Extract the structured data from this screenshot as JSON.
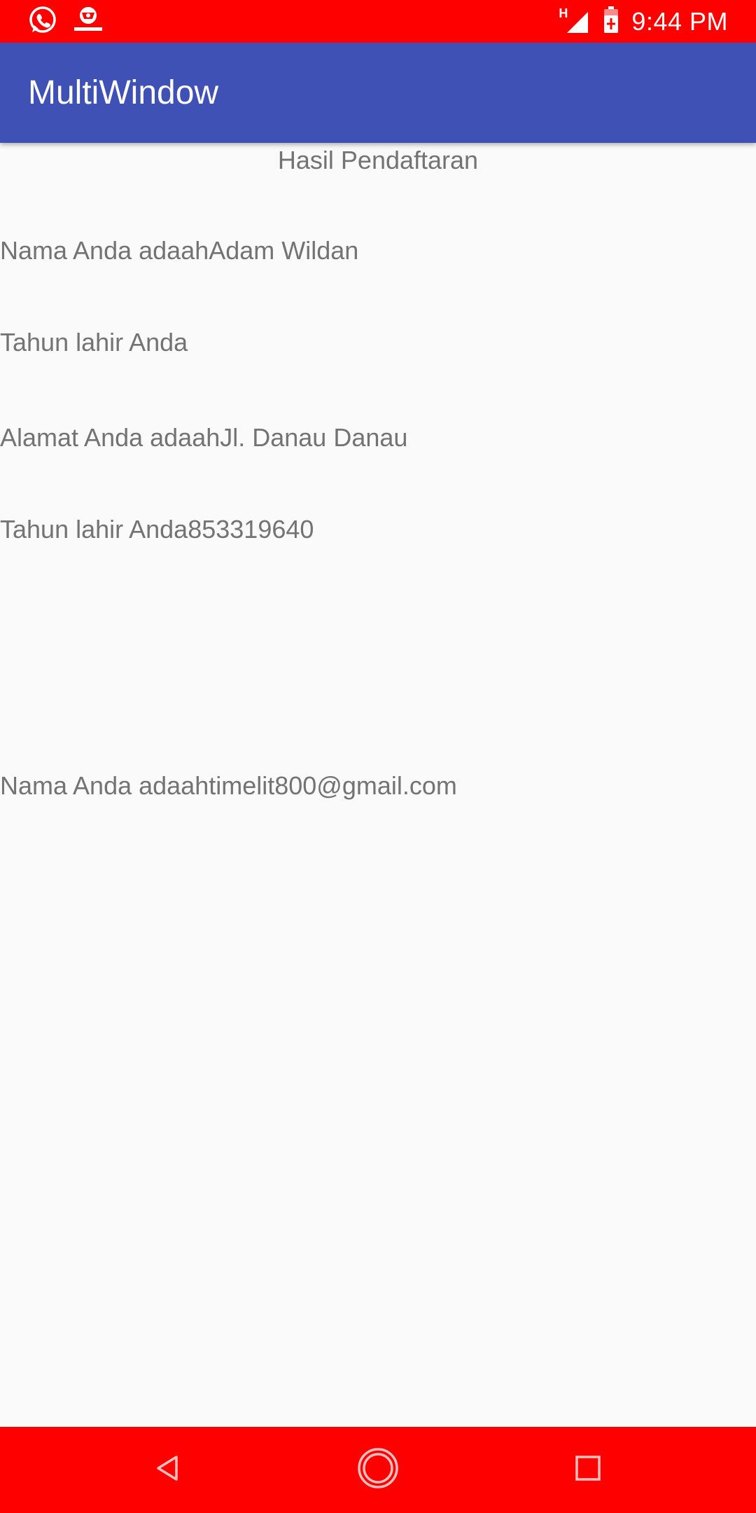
{
  "status_bar": {
    "time": "9:44 PM",
    "network_type": "H",
    "left_icons": [
      "whatsapp-icon",
      "app-logo-icon"
    ],
    "right_icons": [
      "signal-icon",
      "battery-charging-icon"
    ],
    "background_color": "#ff0000"
  },
  "app_bar": {
    "title": "MultiWindow",
    "background_color": "#3f51b5"
  },
  "content": {
    "heading": "Hasil Pendaftaran",
    "lines": [
      "Nama Anda adaahAdam Wildan",
      "Tahun lahir Anda",
      "Alamat Anda adaahJl. Danau Danau",
      "Tahun lahir Anda853319640",
      "Nama Anda adaahtimelit800@gmail.com"
    ],
    "text_color": "#737373"
  },
  "nav_bar": {
    "buttons": [
      "back-icon",
      "home-icon",
      "recents-icon"
    ],
    "background_color": "#ff0000"
  }
}
